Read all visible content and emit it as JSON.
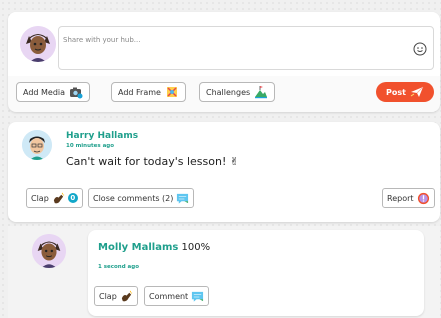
{
  "composer": {
    "placeholder": "Share with your hub...",
    "buttons": {
      "add_media": "Add Media",
      "add_frame": "Add Frame",
      "challenges": "Challenges",
      "post": "Post"
    }
  },
  "post": {
    "author": "Harry Hallams",
    "time": "10 minutes ago",
    "content": "Can't wait for today's lesson! ✌",
    "clap_label": "Clap",
    "clap_count": "0",
    "close_comments": "Close comments (2)",
    "report": "Report"
  },
  "comment": {
    "author": "Molly Mallams",
    "score": "100%",
    "time": "1 second ago",
    "clap_label": "Clap",
    "comment_label": "Comment"
  },
  "colors": {
    "accent_teal": "#1f9f8c",
    "post_button": "#f1512d",
    "badge": "#12a7c9"
  }
}
